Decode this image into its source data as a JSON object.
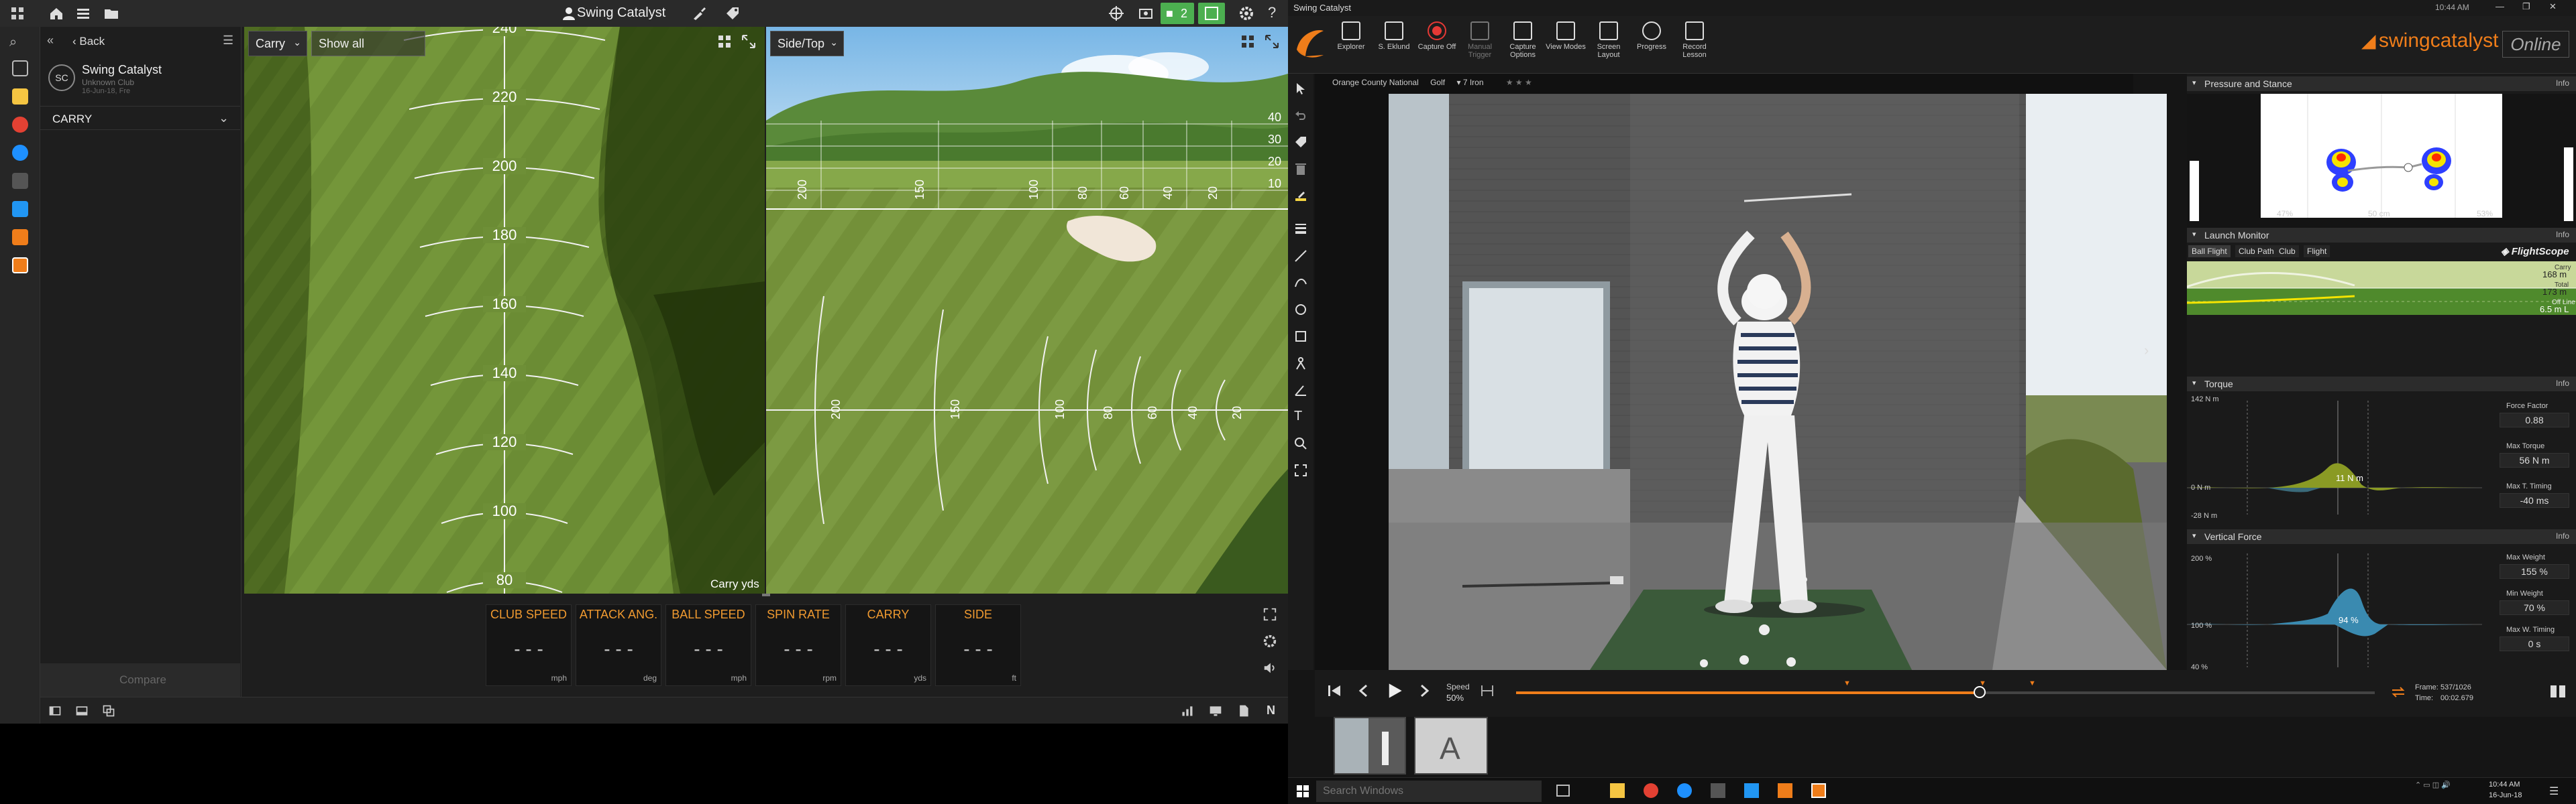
{
  "left_app": {
    "title": "Swing Catalyst",
    "topbar_badges": {
      "camera_count": "2"
    },
    "sidebar": {
      "back_label": "Back",
      "profile_initials": "SC",
      "profile_name": "Swing Catalyst",
      "profile_club": "Unknown Club",
      "profile_date": "16-Jun-18, Fre",
      "section_label": "CARRY",
      "compare_label": "Compare"
    },
    "carry_view": {
      "dropdown_value": "Carry",
      "show_all_label": "Show all",
      "distance_labels": [
        "240",
        "220",
        "200",
        "180",
        "160",
        "140",
        "120",
        "100",
        "80"
      ],
      "unit_label": "Carry yds"
    },
    "side_view": {
      "dropdown_value": "Side/Top",
      "side_right_labels": [
        "40",
        "30",
        "20",
        "10"
      ],
      "side_bottom_labels": [
        "200",
        "150",
        "100",
        "80",
        "60",
        "40",
        "20"
      ],
      "top_labels": [
        "200",
        "150",
        "100",
        "80",
        "60",
        "40",
        "20"
      ]
    },
    "stats": [
      {
        "label": "CLUB SPEED",
        "value": "- - -",
        "unit": "mph"
      },
      {
        "label": "ATTACK ANG.",
        "value": "- - -",
        "unit": "deg"
      },
      {
        "label": "BALL SPEED",
        "value": "- - -",
        "unit": "mph"
      },
      {
        "label": "SPIN RATE",
        "value": "- - -",
        "unit": "rpm"
      },
      {
        "label": "CARRY",
        "value": "- - -",
        "unit": "yds"
      },
      {
        "label": "SIDE",
        "value": "- - -",
        "unit": "ft"
      }
    ],
    "bottom_bar": {
      "n_label": "N"
    }
  },
  "right_app": {
    "title": "Swing Catalyst",
    "clock_top": "10:44 AM",
    "ribbon": {
      "buttons": [
        {
          "label": "Explorer"
        },
        {
          "label": "S. Eklund"
        },
        {
          "label": "Capture Off"
        },
        {
          "label": "Manual Trigger"
        },
        {
          "label": "Capture Options"
        },
        {
          "label": "View Modes"
        },
        {
          "label": "Screen Layout"
        },
        {
          "label": "Progress"
        },
        {
          "label": "Record Lesson"
        }
      ],
      "brand": "swingcatalyst",
      "online_label": "Online"
    },
    "video_header": {
      "location": "Orange County National",
      "sport": "Golf",
      "club": "7 Iron"
    },
    "panels": {
      "pressure": {
        "title": "Pressure and Stance",
        "info": "Info",
        "left_pct": "47%",
        "width": "50 cm",
        "right_pct": "53%"
      },
      "launch": {
        "title": "Launch Monitor",
        "info": "Info",
        "tabs": [
          "Ball Flight",
          "Club Path",
          "Club",
          "Flight"
        ],
        "brand": "FlightScope",
        "carry_label": "Carry",
        "carry_value": "168 m",
        "total_label": "Total",
        "total_value": "173 m",
        "offline_label": "Off Line",
        "offline_value": "6.5 m L"
      },
      "torque": {
        "title": "Torque",
        "info": "Info",
        "y_top": "142 N m",
        "y_zero": "0 N m",
        "y_bottom": "-28 N m",
        "peak_label": "11 N m",
        "force_factor_label": "Force Factor",
        "force_factor_value": "0.88",
        "max_torque_label": "Max Torque",
        "max_torque_value": "56 N m",
        "max_t_timing_label": "Max T. Timing",
        "max_t_timing_value": "-40 ms"
      },
      "vertical": {
        "title": "Vertical Force",
        "info": "Info",
        "y_top": "200 %",
        "y_mid": "100 %",
        "y_bottom": "40 %",
        "peak_label": "94 %",
        "max_weight_label": "Max Weight",
        "max_weight_value": "155 %",
        "min_weight_label": "Min Weight",
        "min_weight_value": "70 %",
        "max_w_timing_label": "Max W. Timing",
        "max_w_timing_value": "0 s"
      }
    },
    "timeline": {
      "speed_label": "Speed",
      "speed_value": "50%",
      "frame_label": "Frame:",
      "frame_value": "537/1026",
      "time_label": "Time:",
      "time_value": "00:02.679",
      "position": 0.54
    },
    "thumb_letter": "A",
    "taskbar": {
      "search_placeholder": "Search Windows",
      "clock": "10:44 AM",
      "date": "16-Jun-18"
    }
  }
}
